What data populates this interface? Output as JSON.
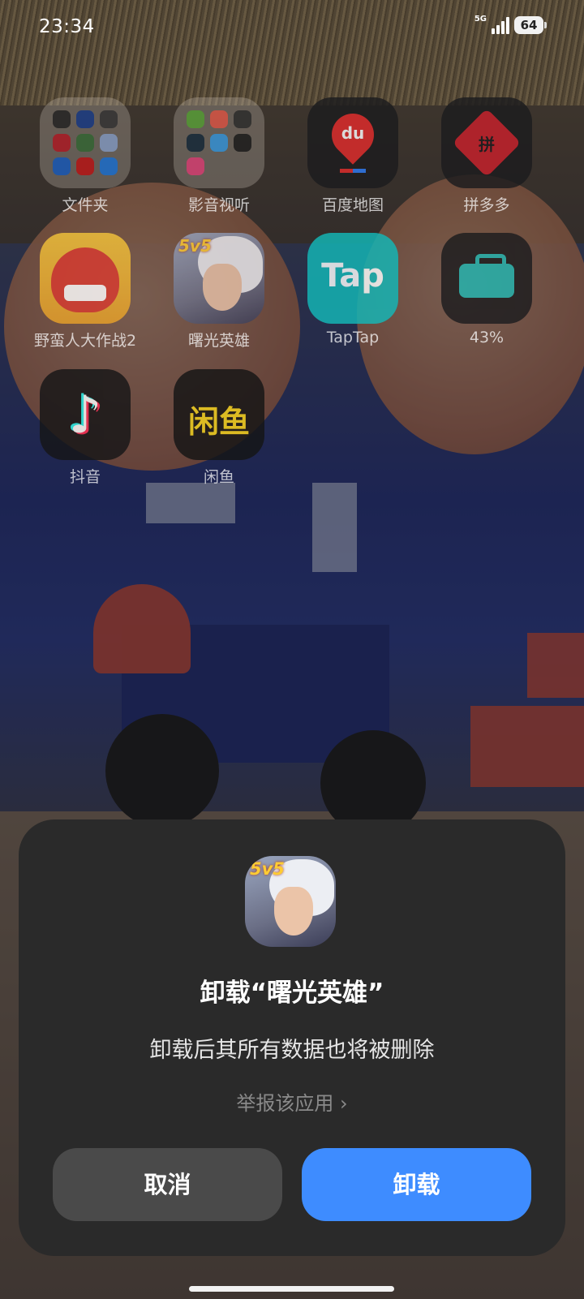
{
  "status_bar": {
    "time": "23:34",
    "network": "5G",
    "battery": "64"
  },
  "apps": [
    {
      "label": "文件夹",
      "icon": "folder-icon"
    },
    {
      "label": "影音视听",
      "icon": "folder-icon"
    },
    {
      "label": "百度地图",
      "icon": "baidu-maps-icon"
    },
    {
      "label": "拼多多",
      "icon": "pinduoduo-icon"
    },
    {
      "label": "野蛮人大作战2",
      "icon": "barbarian-game-icon"
    },
    {
      "label": "曙光英雄",
      "icon": "hero-game-icon"
    },
    {
      "label": "TapTap",
      "icon": "taptap-icon"
    },
    {
      "label": "43%",
      "icon": "toolkit-icon"
    },
    {
      "label": "抖音",
      "icon": "douyin-icon"
    },
    {
      "label": "闲鱼",
      "icon": "xianyu-icon"
    }
  ],
  "icon_text": {
    "maps": "du",
    "taptap": "Tap",
    "xianyu": "闲鱼",
    "pdd": "拼",
    "hero_tag": "5v5"
  },
  "dialog": {
    "title": "卸载“曙光英雄”",
    "message": "卸载后其所有数据也将被删除",
    "report_link": "举报该应用 ›",
    "cancel_label": "取消",
    "confirm_label": "卸载",
    "accent_color": "#3e8cff"
  }
}
